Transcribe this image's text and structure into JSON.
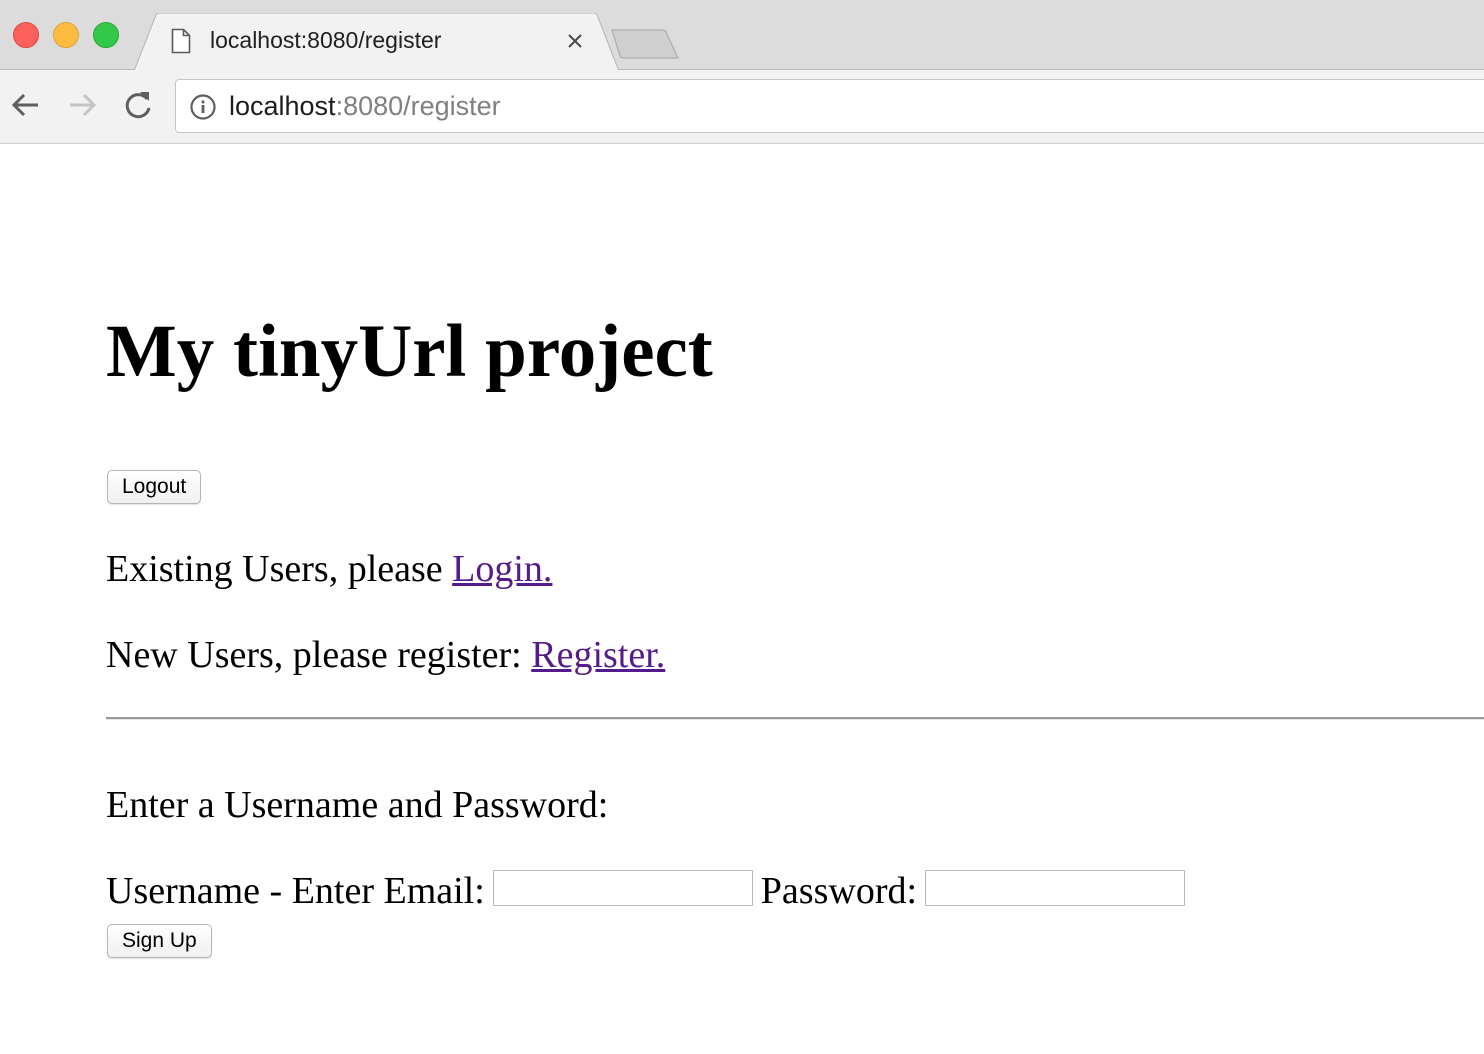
{
  "browser": {
    "tab": {
      "title": "localhost:8080/register"
    },
    "address_bar": {
      "host": "localhost",
      "rest": ":8080/register"
    }
  },
  "page": {
    "title": "My tinyUrl project",
    "logout_label": "Logout",
    "login_prompt": "Existing Users, please ",
    "login_link": "Login.",
    "register_prompt": "New Users, please register: ",
    "register_link": "Register.",
    "form_prompt": "Enter a Username and Password:",
    "username_label": "Username - Enter Email:",
    "username_value": "",
    "password_label": "Password:",
    "password_value": "",
    "signup_label": "Sign Up"
  }
}
